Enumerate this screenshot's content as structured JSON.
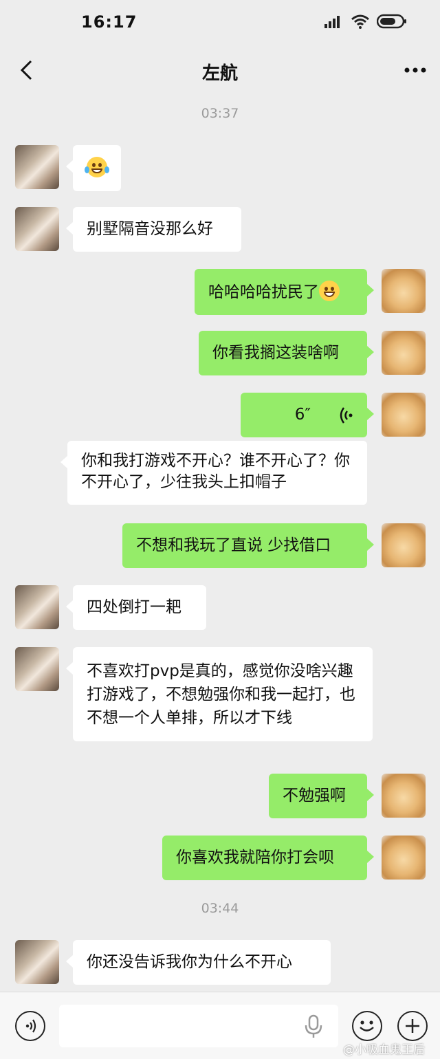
{
  "status_bar": {
    "time": "16:17"
  },
  "header": {
    "title": "左航"
  },
  "timestamps": [
    "03:37",
    "03:44"
  ],
  "messages": [
    {
      "side": "left",
      "text": ""
    },
    {
      "side": "left",
      "text": "别墅隔音没那么好"
    },
    {
      "side": "right",
      "text": "哈哈哈哈扰民了"
    },
    {
      "side": "right",
      "text": "你看我搁这装啥啊"
    },
    {
      "side": "right",
      "voice_duration": "6″"
    },
    {
      "side": "left",
      "text": "你和我打游戏不开心？谁不开心了？你不开心了，少往我头上扣帽子"
    },
    {
      "side": "right",
      "text": "不想和我玩了直说 少找借口"
    },
    {
      "side": "left",
      "text": "四处倒打一耙"
    },
    {
      "side": "left",
      "text": "不喜欢打pvp是真的，感觉你没啥兴趣打游戏了，不想勉强你和我一起打，也不想一个人单排，所以才下线"
    },
    {
      "side": "right",
      "text": "不勉强啊"
    },
    {
      "side": "right",
      "text": "你喜欢我就陪你打会呗"
    },
    {
      "side": "left",
      "text": "你还没告诉我你为什么不开心"
    }
  ],
  "input": {
    "value": ""
  },
  "watermark": "@小吸血鬼王后"
}
